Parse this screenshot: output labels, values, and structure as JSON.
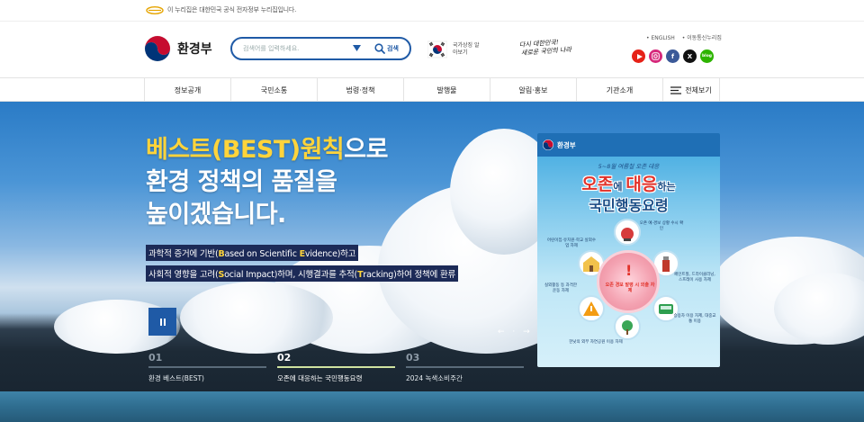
{
  "topbar": {
    "notice": "이 누리집은 대한민국 공식 전자정부 누리집입니다."
  },
  "header": {
    "logo_text": "환경부",
    "search": {
      "placeholder": "검색어를 입력하세요.",
      "button_label": "검색"
    },
    "flag_text": "국가상징 알아보기",
    "slogan_line1": "다시 대한민국!",
    "slogan_line2": "새로운 국민의 나라",
    "utility_links": [
      "ENGLISH",
      "이동통신누리집"
    ],
    "sns": [
      {
        "name": "youtube",
        "color": "#e62117"
      },
      {
        "name": "instagram",
        "color": "#d6287b"
      },
      {
        "name": "facebook",
        "color": "#3b5998"
      },
      {
        "name": "x",
        "color": "#111111"
      },
      {
        "name": "blog",
        "color": "#2db400",
        "label": "blog"
      }
    ]
  },
  "nav": {
    "items": [
      "정보공개",
      "국민소통",
      "법령·정책",
      "발행물",
      "알림·홍보",
      "기관소개"
    ],
    "all_label": "전체보기"
  },
  "hero": {
    "title_highlight": "베스트(BEST)원칙",
    "title_rest_line1": "으로",
    "title_line2": "환경 정책의 품질을",
    "title_line3": "높이겠습니다.",
    "desc_line1": {
      "p1": "과학적 증거에 기반(",
      "k1": "B",
      "p2": "ased on Scientific ",
      "k2": "E",
      "p3": "vidence)하고"
    },
    "desc_line2": {
      "p1": "사회적 영향을 고려(",
      "k1": "S",
      "p2": "ocial Impact)하며, 시행결과를 추적(",
      "k2": "T",
      "p3": "racking)하여 정책에 환류"
    },
    "arrows": "← · →",
    "tabs": [
      {
        "num": "01",
        "label": "환경 베스트(BEST)"
      },
      {
        "num": "02",
        "label": "오존에 대응하는 국민행동요령"
      },
      {
        "num": "03",
        "label": "2024 녹색소비주간"
      }
    ],
    "active_tab": 1
  },
  "poster": {
    "brand": "환경부",
    "subtitle": "5~8월 여름철 오존 대응",
    "title_a": "오존",
    "title_b": "에 ",
    "title_c": "대응",
    "title_d": "하는",
    "title2": "국민행동요령",
    "center_text": "오존 경보 발령 시 외출 자제",
    "labels": [
      "오존 예·경보 상황 수시 확인",
      "어린이집·유치원·학교 실외수업 자제",
      "페인트칠, 드라이클리닝, 스프레이 사용 자제",
      "실외활동 등 과격한 운동 자제",
      "승용차 이용 자제, 대중교통 이용",
      "한낮의 외부 자연공원 이용 자제"
    ]
  }
}
